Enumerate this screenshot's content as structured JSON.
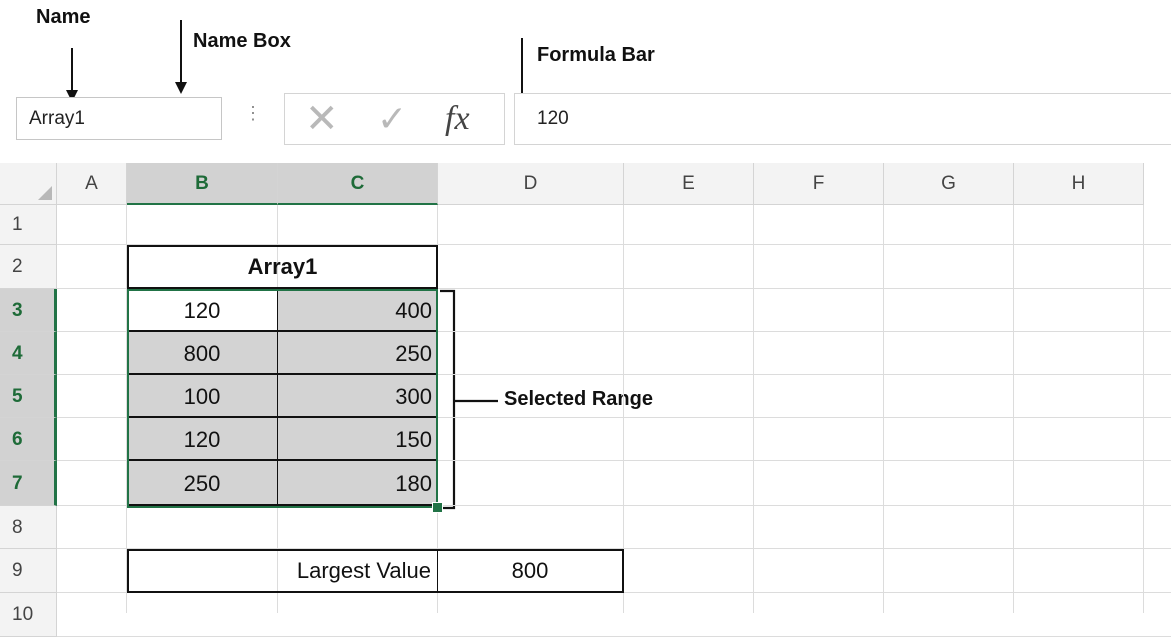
{
  "annotations": {
    "name": "Name",
    "name_box": "Name Box",
    "formula_bar": "Formula Bar",
    "selected_range": "Selected Range"
  },
  "name_box": {
    "value": "Array1"
  },
  "formula_bar": {
    "separator": "⋮",
    "cancel_icon": "✕",
    "enter_icon": "✓",
    "fx_label": "fx",
    "value": "120"
  },
  "columns": [
    "A",
    "B",
    "C",
    "D",
    "E",
    "F",
    "G",
    "H"
  ],
  "selected_columns": [
    "B",
    "C"
  ],
  "rows": [
    "1",
    "2",
    "3",
    "4",
    "5",
    "6",
    "7",
    "8",
    "9",
    "10"
  ],
  "selected_rows": [
    "3",
    "4",
    "5",
    "6",
    "7"
  ],
  "sheet": {
    "array_title": "Array1",
    "array_rows": [
      [
        "120",
        "400"
      ],
      [
        "800",
        "250"
      ],
      [
        "100",
        "300"
      ],
      [
        "120",
        "150"
      ],
      [
        "250",
        "180"
      ]
    ],
    "largest_label": "Largest Value",
    "largest_value": "800"
  }
}
